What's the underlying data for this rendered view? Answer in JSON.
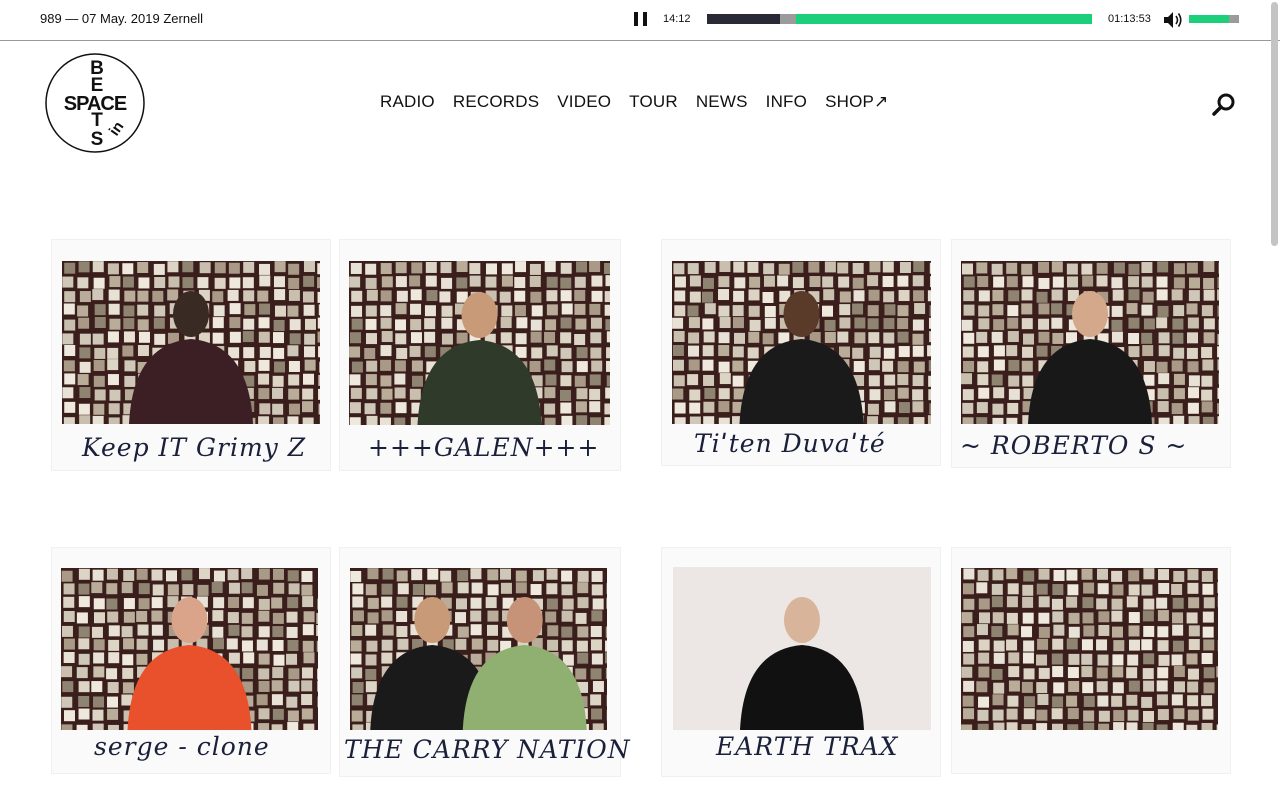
{
  "player": {
    "episode": "989 — 07 May. 2019 Zernell",
    "current_time": "14:12",
    "total_time": "01:13:53",
    "progress_fraction": 0.19,
    "buffered_fraction": 0.23,
    "volume_fraction": 0.8,
    "accent_color": "#1ccf7a"
  },
  "logo": {
    "text": "BEATS in SPACE"
  },
  "nav": {
    "items": [
      "RADIO",
      "RECORDS",
      "VIDEO",
      "TOUR",
      "NEWS",
      "INFO",
      "SHOP↗"
    ]
  },
  "cards": [
    {
      "caption": "Keep IT Grimy Z",
      "photo": "man in black cap and dark hoodie in front of wall of polaroids"
    },
    {
      "caption": "+++GALEN+++",
      "photo": "man in olive jacket in front of wall of polaroids"
    },
    {
      "caption": "Tiˈten Duvaˈté",
      "photo": "man with glasses in black print t-shirt"
    },
    {
      "caption": "~ ROBERTO S ~",
      "photo": "man in black graphic t-shirt"
    },
    {
      "caption": "serge - clone",
      "photo": "man in orange sweater"
    },
    {
      "caption": "THE CARRY NATION",
      "photo": "two men, black t-shirt and green t-shirt"
    },
    {
      "caption": "EARTH TRAX",
      "photo": "man in sunglasses and leather jacket against white wall"
    },
    {
      "caption": "",
      "photo": "wall of polaroid photos"
    }
  ]
}
